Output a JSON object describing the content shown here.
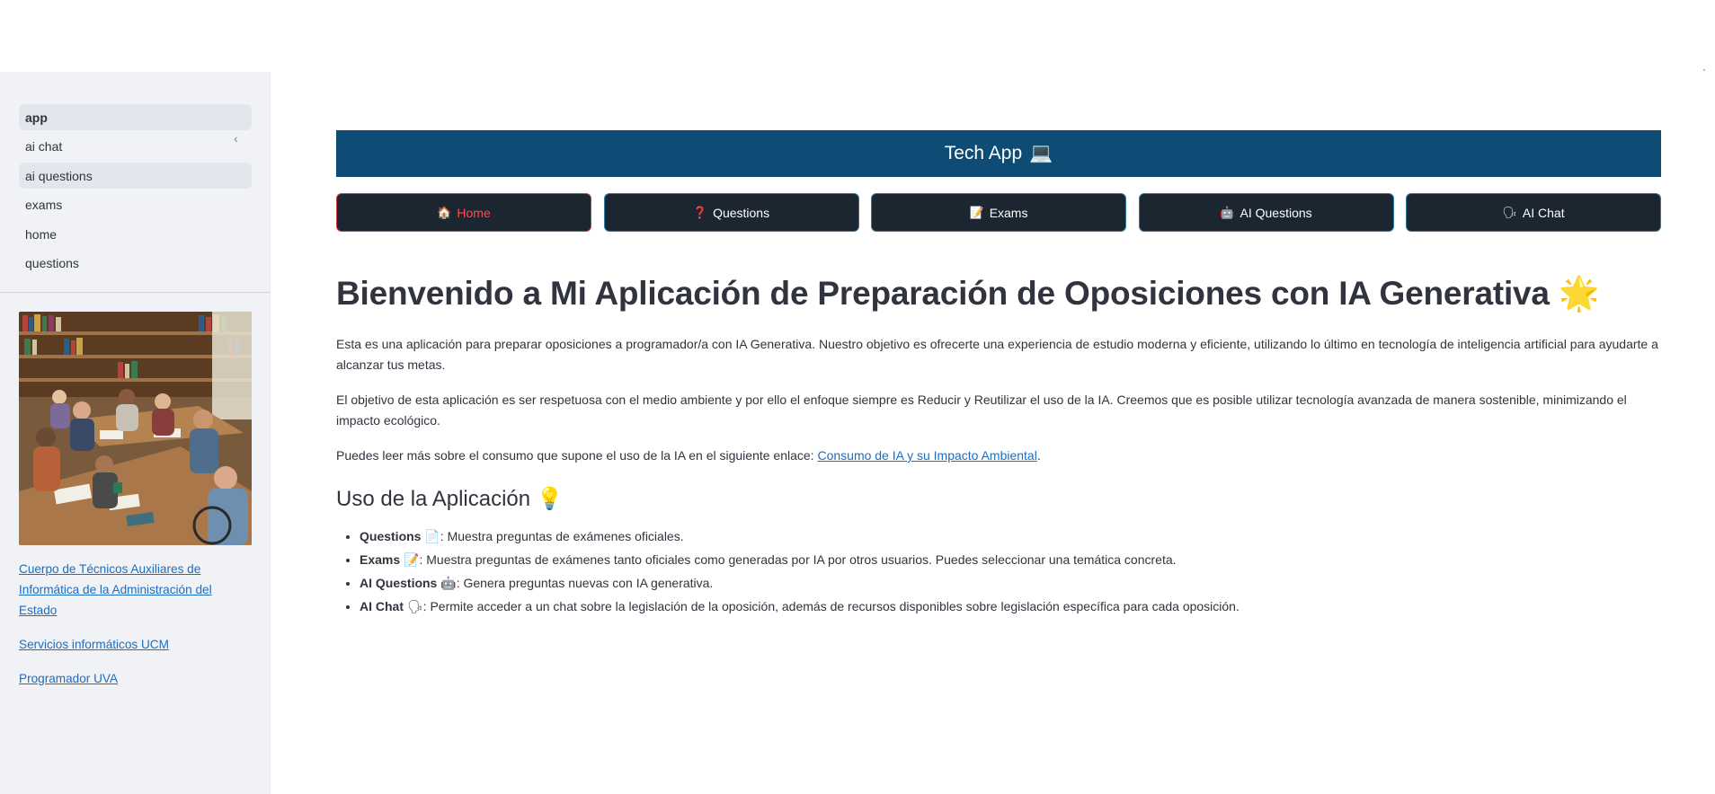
{
  "header": {
    "title": "Tech App",
    "emoji": "💻"
  },
  "top_right_mark": "·",
  "sidebar": {
    "collapse_icon": "‹",
    "items": [
      {
        "label": "app"
      },
      {
        "label": "ai chat"
      },
      {
        "label": "ai questions"
      },
      {
        "label": "exams"
      },
      {
        "label": "home"
      },
      {
        "label": "questions"
      }
    ],
    "links": [
      {
        "label": "Cuerpo de Técnicos Auxiliares de Informática de la Administración del Estado"
      },
      {
        "label": "Servicios informáticos UCM"
      },
      {
        "label": "Programador UVA"
      }
    ]
  },
  "nav_buttons": [
    {
      "icon": "🏠",
      "label": "Home"
    },
    {
      "icon": "❓",
      "label": "Questions"
    },
    {
      "icon": "📝",
      "label": "Exams"
    },
    {
      "icon": "🤖",
      "label": "AI Questions"
    },
    {
      "icon": "🗣",
      "label": "AI Chat"
    }
  ],
  "content": {
    "title": "Bienvenido a Mi Aplicación de Preparación de Oposiciones con IA Generativa",
    "title_emoji": "🌟",
    "paragraph1": "Esta es una aplicación para preparar oposiciones a programador/a con IA Generativa. Nuestro objetivo es ofrecerte una experiencia de estudio moderna y eficiente, utilizando lo último en tecnología de inteligencia artificial para ayudarte a alcanzar tus metas.",
    "paragraph2": "El objetivo de esta aplicación es ser respetuosa con el medio ambiente y por ello el enfoque siempre es Reducir y Reutilizar el uso de la IA. Creemos que es posible utilizar tecnología avanzada de manera sostenible, minimizando el impacto ecológico.",
    "paragraph3_prefix": "Puedes leer más sobre el consumo que supone el uso de la IA en el siguiente enlace: ",
    "paragraph3_link": "Consumo de IA y su Impacto Ambiental",
    "paragraph3_suffix": ".",
    "section_title": "Uso de la Aplicación",
    "section_emoji": "💡",
    "features": [
      {
        "name": "Questions",
        "emoji": "📄",
        "desc": ": Muestra preguntas de exámenes oficiales."
      },
      {
        "name": "Exams",
        "emoji": "📝",
        "desc": ": Muestra preguntas de exámenes tanto oficiales como generadas por IA por otros usuarios. Puedes seleccionar una temática concreta."
      },
      {
        "name": "AI Questions",
        "emoji": "🤖",
        "desc": ": Genera preguntas nuevas con IA generativa."
      },
      {
        "name": "AI Chat",
        "emoji": "🗣",
        "desc": ": Permite acceder a un chat sobre la legislación de la oposición, además de recursos disponibles sobre legislación específica para cada oposición."
      }
    ]
  }
}
